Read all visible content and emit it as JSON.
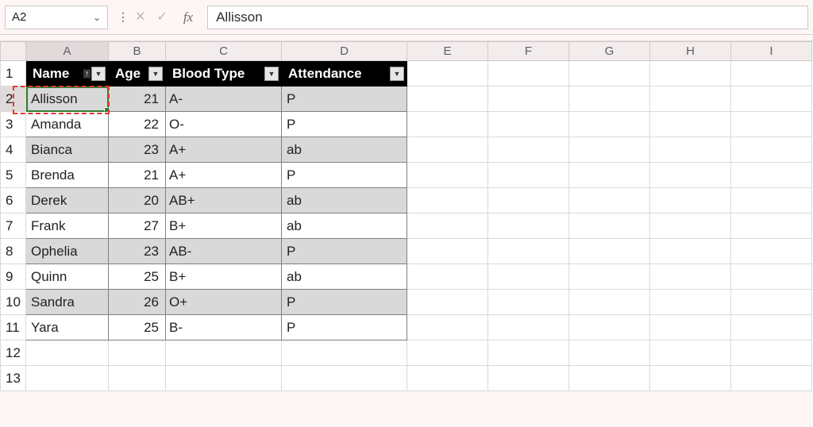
{
  "namebox": {
    "ref": "A2"
  },
  "formula_bar": {
    "value": "Allisson",
    "fx_label": "fx",
    "cancel": "✕",
    "enter": "✓"
  },
  "col_labels": [
    "A",
    "B",
    "C",
    "D",
    "E",
    "F",
    "G",
    "H",
    "I"
  ],
  "row_labels": [
    "1",
    "2",
    "3",
    "4",
    "5",
    "6",
    "7",
    "8",
    "9",
    "10",
    "11",
    "12",
    "13"
  ],
  "selected": {
    "col": "A",
    "row": "2"
  },
  "table": {
    "headers": [
      {
        "label": "Name",
        "sorted_asc": true
      },
      {
        "label": "Age"
      },
      {
        "label": "Blood Type"
      },
      {
        "label": "Attendance"
      }
    ],
    "rows": [
      {
        "name": "Allisson",
        "age": "21",
        "blood": "A-",
        "att": "P"
      },
      {
        "name": "Amanda",
        "age": "22",
        "blood": "O-",
        "att": "P"
      },
      {
        "name": "Bianca",
        "age": "23",
        "blood": "A+",
        "att": "ab"
      },
      {
        "name": "Brenda",
        "age": "21",
        "blood": "A+",
        "att": "P"
      },
      {
        "name": "Derek",
        "age": "20",
        "blood": "AB+",
        "att": "ab"
      },
      {
        "name": "Frank",
        "age": "27",
        "blood": "B+",
        "att": "ab"
      },
      {
        "name": "Ophelia",
        "age": "23",
        "blood": "AB-",
        "att": "P"
      },
      {
        "name": "Quinn",
        "age": "25",
        "blood": "B+",
        "att": "ab"
      },
      {
        "name": "Sandra",
        "age": "26",
        "blood": "O+",
        "att": "P"
      },
      {
        "name": "Yara",
        "age": "25",
        "blood": "B-",
        "att": "P"
      }
    ]
  },
  "glyphs": {
    "dropdown": "▼",
    "sort_asc": "↑"
  }
}
